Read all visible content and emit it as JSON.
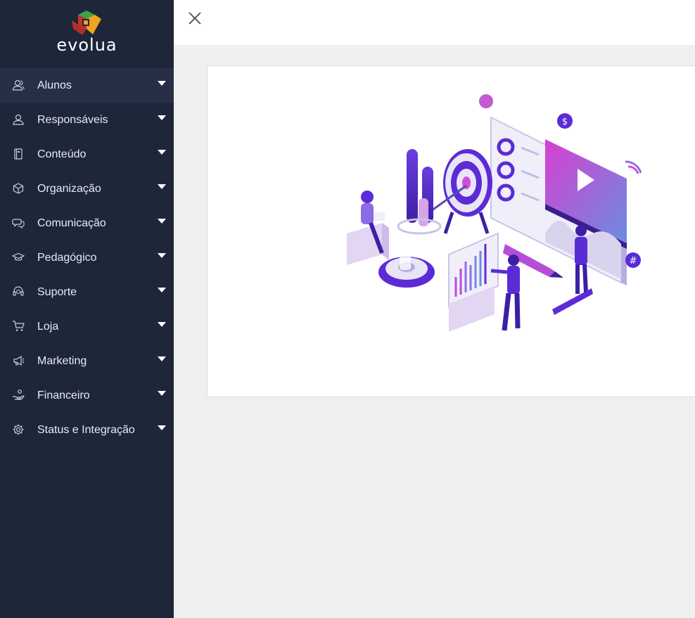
{
  "app": {
    "brand": "evolua"
  },
  "sidebar": {
    "items": [
      {
        "label": "Alunos",
        "icon": "users-icon"
      },
      {
        "label": "Responsáveis",
        "icon": "user-icon"
      },
      {
        "label": "Conteúdo",
        "icon": "book-icon"
      },
      {
        "label": "Organização",
        "icon": "box-icon"
      },
      {
        "label": "Comunicação",
        "icon": "chat-icon"
      },
      {
        "label": "Pedagógico",
        "icon": "graduation-cap-icon"
      },
      {
        "label": "Suporte",
        "icon": "headset-icon"
      },
      {
        "label": "Loja",
        "icon": "cart-icon"
      },
      {
        "label": "Marketing",
        "icon": "megaphone-icon"
      },
      {
        "label": "Financeiro",
        "icon": "hand-coin-icon"
      },
      {
        "label": "Status e Integração",
        "icon": "gear-icon"
      }
    ]
  },
  "colors": {
    "sidebar_bg": "#1e263a",
    "sidebar_active": "#262f46",
    "accent_purple": "#5b2bd6",
    "accent_pink": "#d24dd6"
  },
  "topbar": {
    "close_icon": "close-icon"
  }
}
